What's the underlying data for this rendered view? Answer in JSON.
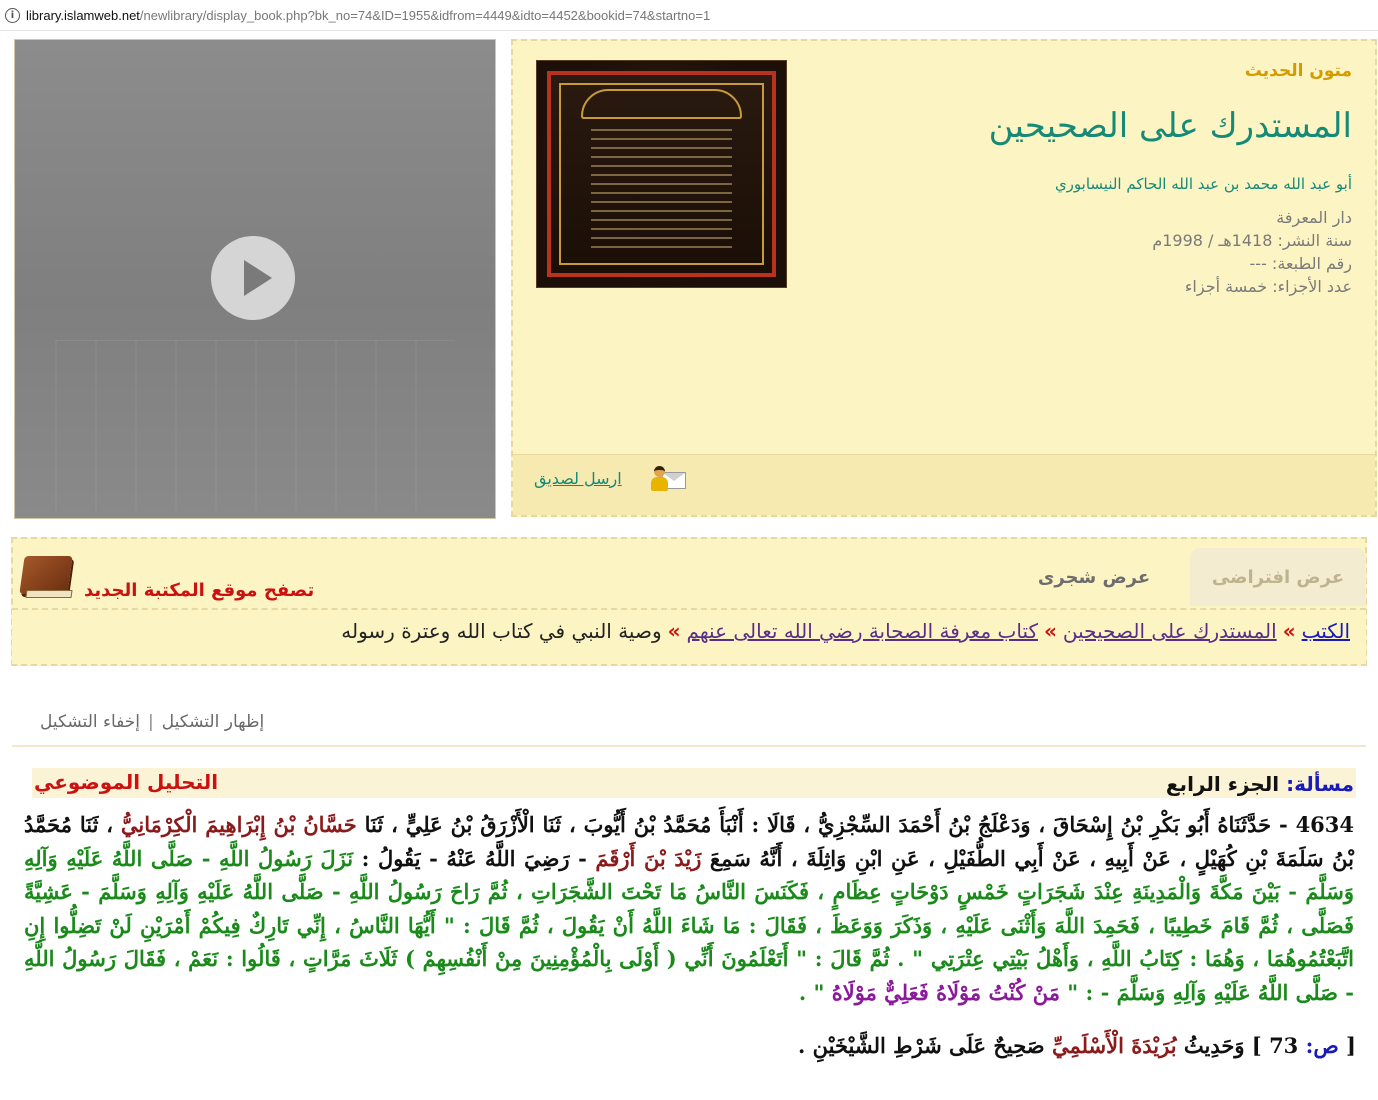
{
  "browser": {
    "url_domain": "library.islamweb.net",
    "url_path": "/newlibrary/display_book.php?bk_no=74&ID=1955&idfrom=4449&idto=4452&bookid=74&startno=1"
  },
  "book": {
    "category": "متون الحديث",
    "title": "المستدرك على الصحيحين",
    "author": "أبو عبد الله محمد بن عبد الله الحاكم النيسابوري",
    "publisher": "دار المعرفة",
    "year": "سنة النشر: 1418هـ / 1998م",
    "edition": "رقم الطبعة: ---",
    "volumes": "عدد الأجزاء: خمسة أجزاء",
    "send_to_friend": "ارسل لصديق"
  },
  "tabs": {
    "virtual": "عرض افتراضى",
    "tree": "عرض شجرى"
  },
  "new_site_link": "تصفح موقع المكتبة الجديد",
  "breadcrumb": {
    "sep": "»",
    "items": [
      "الكتب",
      "المستدرك على الصحيحين",
      "كتاب معرفة الصحابة رضي الله تعالى عنهم"
    ],
    "current": "وصية النبي في كتاب الله وعترة رسوله"
  },
  "diacritics": {
    "show": "إظهار التشكيل",
    "hide": "إخفاء التشكيل",
    "separator": "|"
  },
  "content": {
    "masala_label": "مسألة:",
    "masala_value": "الجزء الرابع",
    "topical_analysis": "التحليل الموضوعي",
    "hadith": {
      "t1": "4634 - حَدَّثَنَاهُ أَبُو بَكْرِ بْنُ إِسْحَاقَ ، وَدَعْلَجُ بْنُ أَحْمَدَ السِّجْزِيُّ ، قَالَا : أَنْبَأَ مُحَمَّدُ بْنُ أَيُّوبَ ، ثَنَا الْأَزْرَقُ بْنُ عَلِيٍّ ، ثَنَا ",
      "n1": "حَسَّانُ بْنُ إِبْرَاهِيمَ الْكِرْمَانِيُّ",
      "t2": " ، ثَنَا مُحَمَّدُ بْنُ سَلَمَةَ بْنِ كُهَيْلٍ ، عَنْ أَبِيهِ ، عَنْ أَبِي الطُّفَيْلِ ، عَنِ ابْنِ وَاثِلَةَ ، أَنَّهُ سَمِعَ ",
      "n2": "زَيْدَ بْنَ أَرْقَمَ",
      "t3": " - رَضِيَ اللَّهُ عَنْهُ - يَقُولُ : ",
      "g1": "نَزَلَ رَسُولُ اللَّهِ - صَلَّى اللَّهُ عَلَيْهِ وَآلِهِ وَسَلَّمَ - بَيْنَ مَكَّةَ وَالْمَدِينَةِ عِنْدَ شَجَرَاتٍ خَمْسٍ دَوْحَاتٍ عِظَامٍ ، فَكَنَسَ النَّاسُ مَا تَحْتَ الشَّجَرَاتِ ، ثُمَّ رَاحَ رَسُولُ اللَّهِ - صَلَّى اللَّهُ عَلَيْهِ وَآلِهِ وَسَلَّمَ - عَشِيَّةً فَصَلَّى ، ثُمَّ قَامَ خَطِيبًا ، فَحَمِدَ اللَّهَ وَأَثْنَى عَلَيْهِ ، وَذَكَرَ وَوَعَظَ ، فَقَالَ : مَا شَاءَ اللَّهُ أَنْ يَقُولَ ، ثُمَّ قَالَ : \" أَيُّهَا النَّاسُ ، إِنِّي تَارِكٌ فِيكُمْ أَمْرَيْنِ لَنْ تَضِلُّوا إِنِ اتَّبَعْتُمُوهُمَا ، وَهُمَا : كِتَابُ اللَّهِ ، وَأَهْلُ بَيْتِي عِتْرَتِي \" . ثُمَّ قَالَ : \" أَتَعْلَمُونَ أَنِّي ( أَوْلَى بِالْمُؤْمِنِينَ مِنْ أَنْفُسِهِمْ ) ثَلَاثَ مَرَّاتٍ ، قَالُوا : نَعَمْ ، فَقَالَ رَسُولُ اللَّهِ - صَلَّى اللَّهُ عَلَيْهِ وَآلِهِ وَسَلَّمَ - : \" ",
      "p1": "مَنْ كُنْتُ مَوْلَاهُ فَعَلِيٌّ مَوْلَاهُ",
      "t4": " \" ."
    },
    "page_label": "ص:",
    "page_num": "73",
    "note_pre": " ] وَحَدِيثُ ",
    "note_narr": "بُرَيْدَةَ الْأَسْلَمِيِّ",
    "note_post": " صَحِيحٌ عَلَى شَرْطِ الشَّيْخَيْنِ ."
  }
}
